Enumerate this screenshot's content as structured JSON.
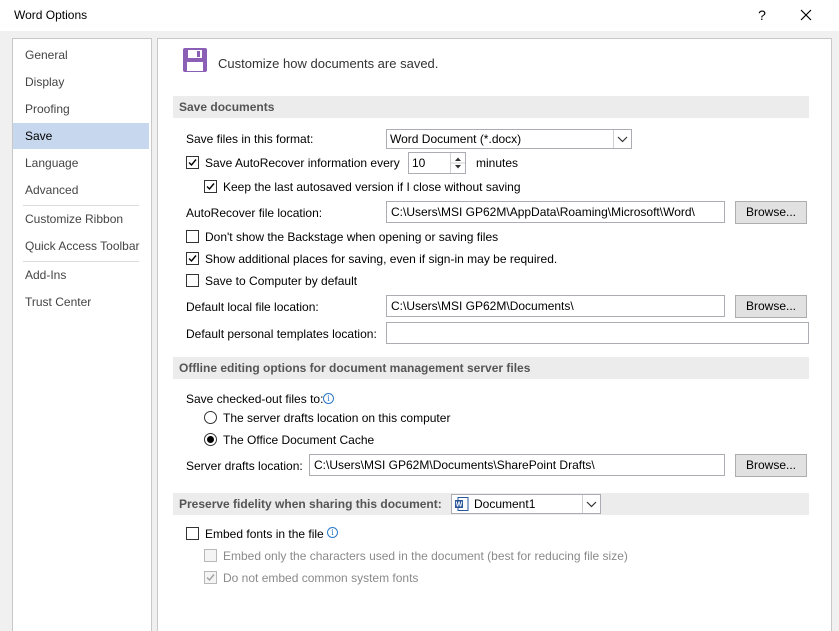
{
  "window": {
    "title": "Word Options",
    "help": "?"
  },
  "sidebar": {
    "items": [
      {
        "label": "General"
      },
      {
        "label": "Display"
      },
      {
        "label": "Proofing"
      },
      {
        "label": "Save"
      },
      {
        "label": "Language"
      },
      {
        "label": "Advanced"
      },
      {
        "label": "Customize Ribbon"
      },
      {
        "label": "Quick Access Toolbar"
      },
      {
        "label": "Add-Ins"
      },
      {
        "label": "Trust Center"
      }
    ],
    "selected": "Save"
  },
  "header": {
    "text": "Customize how documents are saved."
  },
  "save_documents": {
    "heading": "Save documents",
    "format_label": "Save files in this format:",
    "format_value": "Word Document (*.docx)",
    "autorecover_label": "Save AutoRecover information every",
    "autorecover_checked": true,
    "autorecover_minutes": "10",
    "minutes_label": "minutes",
    "keep_last_label": "Keep the last autosaved version if I close without saving",
    "keep_last_checked": true,
    "autorecover_location_label": "AutoRecover file location:",
    "autorecover_location_value": "C:\\Users\\MSI GP62M\\AppData\\Roaming\\Microsoft\\Word\\",
    "browse_label": "Browse...",
    "backstage_label": "Don't show the Backstage when opening or saving files",
    "backstage_checked": false,
    "additional_places_label": "Show additional places for saving, even if sign-in may be required.",
    "additional_places_checked": true,
    "save_computer_label": "Save to Computer by default",
    "save_computer_checked": false,
    "local_location_label": "Default local file location:",
    "local_location_value": "C:\\Users\\MSI GP62M\\Documents\\",
    "templates_label": "Default personal templates location:",
    "templates_value": ""
  },
  "offline": {
    "heading": "Offline editing options for document management server files",
    "checked_out_label": "Save checked-out files to:",
    "server_drafts_option": "The server drafts location on this computer",
    "office_cache_option": "The Office Document Cache",
    "selected_option": "office_cache",
    "drafts_location_label": "Server drafts location:",
    "drafts_location_value": "C:\\Users\\MSI GP62M\\Documents\\SharePoint Drafts\\",
    "browse_label": "Browse..."
  },
  "fidelity": {
    "heading": "Preserve fidelity when sharing this document:",
    "document_value": "Document1",
    "embed_fonts_label": "Embed fonts in the file",
    "embed_fonts_checked": false,
    "embed_chars_label": "Embed only the characters used in the document (best for reducing file size)",
    "embed_chars_checked": false,
    "no_common_label": "Do not embed common system fonts",
    "no_common_checked": true
  },
  "colors": {
    "selected_nav": "#c7d7ee",
    "save_icon": "#8b5fb5",
    "info_icon": "#2b78c6",
    "word_blue": "#2b579a"
  }
}
